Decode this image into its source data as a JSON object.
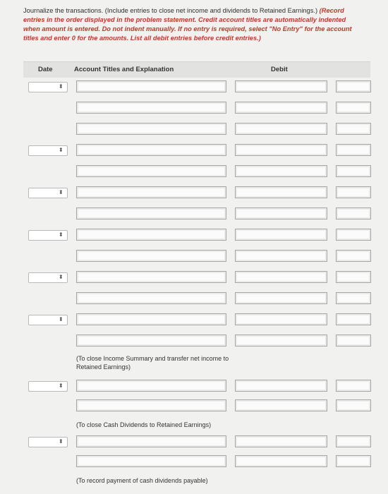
{
  "instructions": {
    "plain": "Journalize the transactions. (Include entries to close net income and dividends to Retained Earnings.) ",
    "emphasis": "(Record entries in the order displayed in the problem statement. Credit account titles are automatically indented when amount is entered. Do not indent manually. If no entry is required, select \"No Entry\" for the account titles and enter 0 for the amounts. List all debit entries before credit entries.)"
  },
  "table": {
    "headers": {
      "date": "Date",
      "account": "Account Titles and Explanation",
      "debit": "Debit"
    }
  },
  "icons": {
    "date_dropdown": "updown-arrow-icon"
  },
  "notes": {
    "close_income_summary": "(To close Income Summary and transfer net income to Retained Earnings)",
    "close_dividends": "(To close Cash Dividends to Retained Earnings)",
    "record_payment": "(To record payment of cash dividends payable)"
  },
  "glyphs": {
    "updown": "⬍"
  }
}
